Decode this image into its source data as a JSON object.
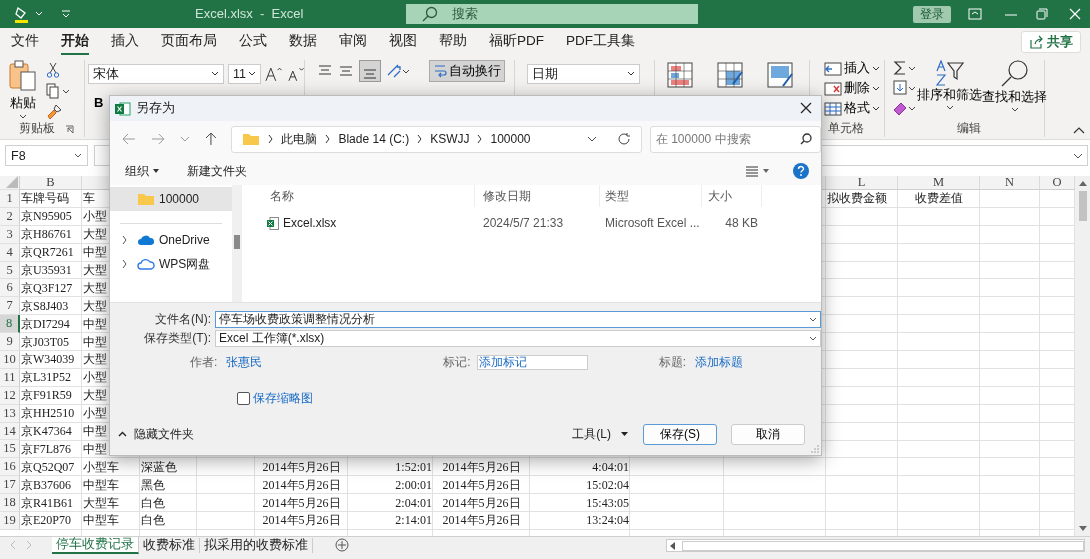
{
  "title_bar": {
    "title": "Excel.xlsx  -  Excel",
    "search_placeholder": "搜索",
    "sign_in": "登录"
  },
  "menu_tabs": [
    {
      "label": "文件",
      "selected": false
    },
    {
      "label": "开始",
      "selected": true
    },
    {
      "label": "插入",
      "selected": false
    },
    {
      "label": "页面布局",
      "selected": false
    },
    {
      "label": "公式",
      "selected": false
    },
    {
      "label": "数据",
      "selected": false
    },
    {
      "label": "审阅",
      "selected": false
    },
    {
      "label": "视图",
      "selected": false
    },
    {
      "label": "帮助",
      "selected": false
    },
    {
      "label": "福昕PDF",
      "selected": false
    },
    {
      "label": "PDF工具集",
      "selected": false
    }
  ],
  "share": "共享",
  "ribbon": {
    "paste": "粘贴",
    "clipboard_label": "剪贴板",
    "font_name": "宋体",
    "font_size": "11",
    "bold": "B",
    "wrap_text": {
      "label": "自动换行",
      "on": true
    },
    "number_format": "日期",
    "cells_items": [
      {
        "label": "插入",
        "kind": "insert"
      },
      {
        "label": "删除",
        "kind": "delete"
      },
      {
        "label": "格式",
        "kind": "format"
      }
    ],
    "cells_label": "单元格",
    "sort": "排序和筛选",
    "find": "查找和选择",
    "editing_label": "编辑"
  },
  "name_box": "F8",
  "sheet": {
    "headers": {
      "B": "B",
      "L": "L",
      "M": "M",
      "N": "N",
      "O": "O"
    },
    "rows": [
      {
        "number": "1",
        "active": false,
        "cells": {
          "B": "车牌号码",
          "C": "车",
          "L": "拟收费金额",
          "M": "收费差值"
        }
      },
      {
        "number": "2",
        "active": false,
        "cells": {
          "B": "京N95905",
          "C": "小型"
        }
      },
      {
        "number": "3",
        "active": false,
        "cells": {
          "B": "京H86761",
          "C": "大型"
        }
      },
      {
        "number": "4",
        "active": false,
        "cells": {
          "B": "京QR7261",
          "C": "中型"
        }
      },
      {
        "number": "5",
        "active": false,
        "cells": {
          "B": "京U35931",
          "C": "大型"
        }
      },
      {
        "number": "6",
        "active": false,
        "cells": {
          "B": "京Q3F127",
          "C": "大型"
        }
      },
      {
        "number": "7",
        "active": false,
        "cells": {
          "B": "京S8J403",
          "C": "大型"
        }
      },
      {
        "number": "8",
        "active": true,
        "cells": {
          "B": "京DI7294",
          "C": "中型"
        }
      },
      {
        "number": "9",
        "active": false,
        "cells": {
          "B": "京J03T05",
          "C": "中型"
        }
      },
      {
        "number": "10",
        "active": false,
        "cells": {
          "B": "京W34039",
          "C": "大型"
        }
      },
      {
        "number": "11",
        "active": false,
        "cells": {
          "B": "京L31P52",
          "C": "小型"
        }
      },
      {
        "number": "12",
        "active": false,
        "cells": {
          "B": "京F91R59",
          "C": "大型"
        }
      },
      {
        "number": "13",
        "active": false,
        "cells": {
          "B": "京HH2510",
          "C": "小型"
        }
      },
      {
        "number": "14",
        "active": false,
        "cells": {
          "B": "京K47364",
          "C": "中型"
        }
      },
      {
        "number": "15",
        "active": false,
        "cells": {
          "B": "京F7L876",
          "C": "中型"
        }
      },
      {
        "number": "16",
        "active": false,
        "cells": {
          "B": "京Q52Q07",
          "C": "小型车",
          "D": "深蓝色",
          "F": "2014年5月26日",
          "G": "1:52:01",
          "H": "2014年5月26日",
          "I": "4:04:01"
        }
      },
      {
        "number": "17",
        "active": false,
        "cells": {
          "B": "京B37606",
          "C": "中型车",
          "D": "黑色",
          "F": "2014年5月26日",
          "G": "2:00:01",
          "H": "2014年5月26日",
          "I": "15:02:04"
        }
      },
      {
        "number": "18",
        "active": false,
        "cells": {
          "B": "京R41B61",
          "C": "大型车",
          "D": "白色",
          "F": "2014年5月26日",
          "G": "2:04:01",
          "H": "2014年5月26日",
          "I": "15:43:05"
        }
      },
      {
        "number": "19",
        "active": false,
        "cells": {
          "B": "京E20P70",
          "C": "中型车",
          "D": "白色",
          "F": "2014年5月26日",
          "G": "2:14:01",
          "H": "2014年5月26日",
          "I": "13:24:04"
        }
      }
    ]
  },
  "dialog": {
    "title": "另存为",
    "breadcrumbs": [
      "此电脑",
      "Blade 14 (C:)",
      "KSWJJ",
      "100000"
    ],
    "search_placeholder": "在 100000 中搜索",
    "organize": "组织",
    "new_folder": "新建文件夹",
    "nav": [
      {
        "label": "100000",
        "kind": "folder",
        "selected": true
      },
      {
        "label": "OneDrive",
        "kind": "onedrive",
        "selected": false
      },
      {
        "label": "WPS网盘",
        "kind": "cloud",
        "selected": false
      }
    ],
    "columns": [
      "名称",
      "修改日期",
      "类型",
      "大小"
    ],
    "files": [
      {
        "name": "Excel.xlsx",
        "modified": "2024/5/7 21:33",
        "type": "Microsoft Excel ...",
        "size": "48 KB"
      }
    ],
    "file_name_label": "文件名(N):",
    "file_name": "停车场收费政策调整情况分析",
    "save_type_label": "保存类型(T):",
    "save_type": "Excel 工作簿(*.xlsx)",
    "author_label": "作者:",
    "author": "张惠民",
    "tags_label": "标记:",
    "tags_placeholder": "添加标记",
    "title_label": "标题:",
    "title_value": "添加标题",
    "thumbnail": {
      "label": "保存缩略图",
      "checked": false
    },
    "hide_folders": "隐藏文件夹",
    "tools": "工具(L)",
    "save": "保存(S)",
    "cancel": "取消"
  },
  "sheet_tabs": [
    {
      "label": "停车收费记录",
      "selected": true
    },
    {
      "label": "收费标准",
      "selected": false
    },
    {
      "label": "拟采用的收费标准",
      "selected": false
    }
  ]
}
